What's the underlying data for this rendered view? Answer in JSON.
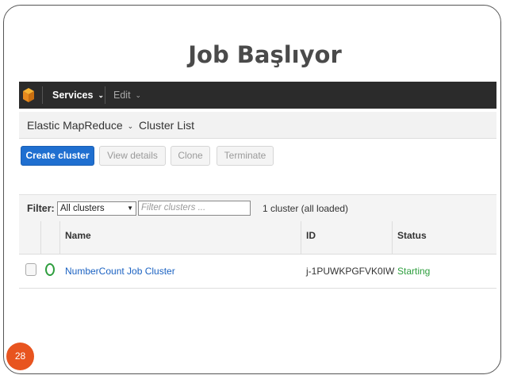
{
  "slide": {
    "title": "Job Başlıyor",
    "page_number": "28"
  },
  "topbar": {
    "services_label": "Services",
    "edit_label": "Edit"
  },
  "subbar": {
    "service_label": "Elastic MapReduce",
    "view_label": "Cluster List"
  },
  "toolbar": {
    "create_label": "Create cluster",
    "view_details_label": "View details",
    "clone_label": "Clone",
    "terminate_label": "Terminate"
  },
  "filter": {
    "label": "Filter:",
    "selected_option": "All clusters",
    "placeholder": "Filter clusters ...",
    "count_text": "1 cluster (all loaded)"
  },
  "table": {
    "headers": {
      "name": "Name",
      "id": "ID",
      "status": "Status"
    },
    "rows": [
      {
        "name": "NumberCount Job Cluster",
        "id": "j-1PUWKPGFVK0IW",
        "status": "Starting"
      }
    ]
  },
  "colors": {
    "accent": "#1f6fd0",
    "status_starting": "#2e9e3e",
    "page_badge": "#e8541f"
  }
}
